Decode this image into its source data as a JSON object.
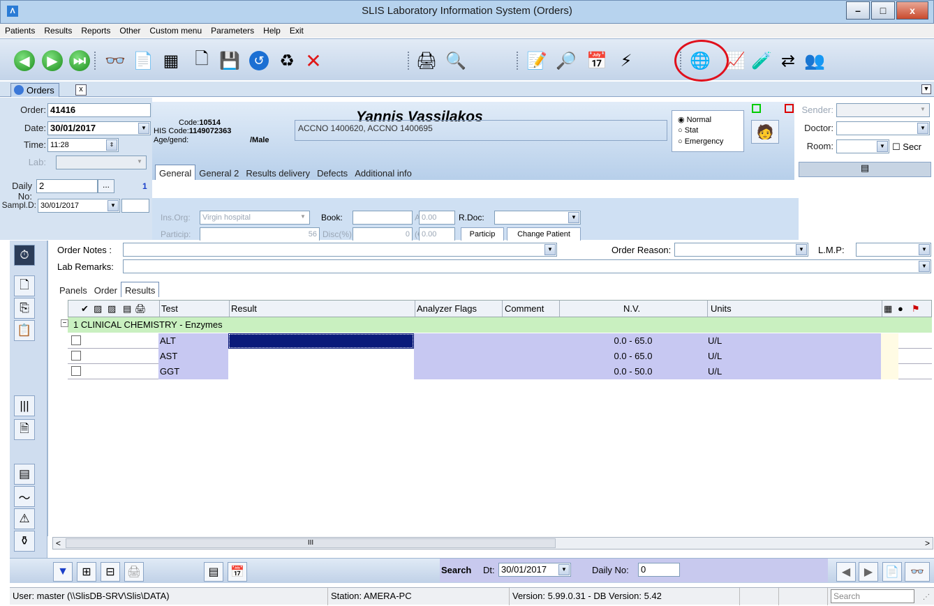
{
  "window": {
    "title": "SLIS Laboratory Information System (Orders)",
    "minimize": "–",
    "maximize": "□",
    "close": "x"
  },
  "menu": [
    "Patients",
    "Results",
    "Reports",
    "Other",
    "Custom menu",
    "Parameters",
    "Help",
    "Exit"
  ],
  "doc_tab": {
    "label": "Orders",
    "close": "x"
  },
  "order": {
    "order_label": "Order:",
    "order_no": "41416",
    "date_label": "Date:",
    "date": "30/01/2017",
    "time_label": "Time:",
    "time": "11:28",
    "lab_label": "Lab:",
    "daily_label": "Daily No:",
    "daily_no": "2",
    "daily_btn": "...",
    "daily_count": "1",
    "sampl_label": "Sampl.D:",
    "sampl_date": "30/01/2017"
  },
  "patient": {
    "name": "Yannis Vassilakos",
    "code_label": "Code:",
    "code": "10514",
    "his_label": "HIS Code:",
    "his_code": "1149072363",
    "age_label": "Age/gend:",
    "gender": "/Male",
    "accno": "ACCNO 1400620, ACCNO 1400695"
  },
  "priority": {
    "normal": "Normal",
    "stat": "Stat",
    "emergency": "Emergency"
  },
  "right": {
    "sender_label": "Sender:",
    "doctor_label": "Doctor:",
    "room_label": "Room:",
    "secr_label": "Secr"
  },
  "tabs": [
    "General",
    "General 2",
    "Results delivery",
    "Defects",
    "Additional info"
  ],
  "general": {
    "ins_org_label": "Ins.Org:",
    "ins_org": "Virgin hospital",
    "book_label": "Book:",
    "abs_label": "Abs:",
    "abs_val": "0.00",
    "rdoc_label": "R.Doc:",
    "particip_label": "Particip:",
    "particip_val": "56",
    "disc_label": "Disc(%):",
    "disc_val": "0",
    "eur_label": "(€):",
    "eur_val": "0.00",
    "particip_btn": "Particip",
    "change_btn": "Change Patient"
  },
  "notes": {
    "order_notes": "Order Notes :",
    "lab_remarks": "Lab Remarks:",
    "order_reason": "Order Reason:",
    "lmp": "L.M.P:"
  },
  "subtabs": [
    "Panels",
    "Order",
    "Results"
  ],
  "grid": {
    "headers": {
      "test": "Test",
      "result": "Result",
      "flags": "Analyzer Flags",
      "comment": "Comment",
      "nv": "N.V.",
      "units": "Units"
    },
    "group": "1 CLINICAL CHEMISTRY - Enzymes",
    "rows": [
      {
        "test": "ALT",
        "nv": "0.0 - 65.0",
        "units": "U/L"
      },
      {
        "test": "AST",
        "nv": "0.0 - 65.0",
        "units": "U/L"
      },
      {
        "test": "GGT",
        "nv": "0.0 - 50.0",
        "units": "U/L"
      }
    ]
  },
  "scroll": {
    "left": "<",
    "mid": "III",
    "right": ">"
  },
  "search": {
    "label": "Search",
    "dt_label": "Dt:",
    "dt": "30/01/2017",
    "daily_label": "Daily No:",
    "daily": "0"
  },
  "status": {
    "user": "User: master  (\\\\SlisDB-SRV\\Slis\\DATA)",
    "station": "Station: AMERA-PC",
    "version": "Version: 5.99.0.31  -  DB Version: 5.42",
    "search_placeholder": "Search"
  }
}
